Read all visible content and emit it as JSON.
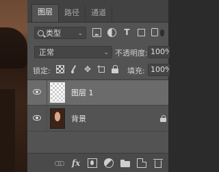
{
  "tabs": [
    {
      "label": "图层",
      "active": true
    },
    {
      "label": "路径",
      "active": false
    },
    {
      "label": "通道",
      "active": false
    }
  ],
  "filter": {
    "kind_label": "类型",
    "icons": [
      "image-filter-icon",
      "adjustment-filter-icon",
      "type-filter-icon",
      "shape-filter-icon",
      "smart-object-filter-icon"
    ]
  },
  "blend": {
    "mode": "正常",
    "opacity_label": "不透明度:",
    "opacity_value": "100%"
  },
  "lock": {
    "label": "锁定:",
    "fill_label": "填充:",
    "fill_value": "100%",
    "icons": [
      "lock-transparent-icon",
      "lock-image-icon",
      "lock-position-icon",
      "lock-artboard-icon",
      "lock-all-icon"
    ]
  },
  "layers": [
    {
      "name": "图层 1",
      "visible": true,
      "selected": true,
      "thumbnail": "transparent"
    },
    {
      "name": "背景",
      "visible": true,
      "selected": false,
      "thumbnail": "photo",
      "locked": true
    }
  ],
  "bottom_icons": [
    "link-layers-icon",
    "fx-icon",
    "add-mask-icon",
    "adjustment-layer-icon",
    "new-group-icon",
    "new-layer-icon",
    "delete-layer-icon"
  ],
  "colors": {
    "panel": "#535353",
    "selected_layer": "#6b6b6b",
    "tab_bar": "#424242"
  }
}
